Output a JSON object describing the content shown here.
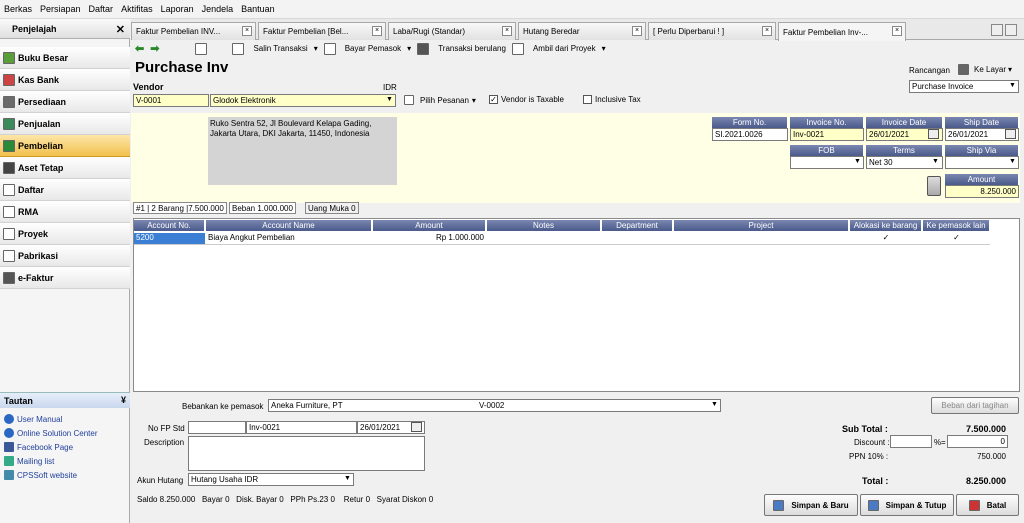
{
  "menu": [
    "Berkas",
    "Persiapan",
    "Daftar",
    "Aktifitas",
    "Laporan",
    "Jendela",
    "Bantuan"
  ],
  "sidebar": {
    "title": "Penjelajah",
    "close": "✕",
    "items": [
      {
        "label": "Buku Besar"
      },
      {
        "label": "Kas Bank"
      },
      {
        "label": "Persediaan"
      },
      {
        "label": "Penjualan"
      },
      {
        "label": "Pembelian"
      },
      {
        "label": "Aset Tetap"
      },
      {
        "label": "Daftar"
      },
      {
        "label": "RMA"
      },
      {
        "label": "Proyek"
      },
      {
        "label": "Pabrikasi"
      },
      {
        "label": "e-Faktur"
      }
    ],
    "tautan": "Tautan",
    "links": [
      "User Manual",
      "Online Solution Center",
      "Facebook Page",
      "Mailing list",
      "CPSSoft website"
    ]
  },
  "tabs": [
    "Faktur Pembelian INV...",
    "Faktur Pembelian [Bel...",
    "Laba/Rugi (Standar)",
    "Hutang Beredar",
    "[ Perlu Diperbarui ! ]",
    "Faktur Pembelian Inv-..."
  ],
  "toolbar": {
    "salin": "Salin Transaksi",
    "bayar": "Bayar Pemasok",
    "berulang": "Transaksi berulang",
    "ambil": "Ambil dari Proyek"
  },
  "form": {
    "title": "Purchase Inv",
    "vendor_label": "Vendor",
    "currency": "IDR",
    "vendor_no": "V-0001",
    "vendor_name": "Glodok Elektronik",
    "pilih": "Pilih Pesanan",
    "taxable": "Vendor is Taxable",
    "inclusive": "Inclusive Tax",
    "address": "Ruko Sentra 52, Jl Boulevard Kelapa Gading, Jakarta Utara, DKI Jakarta, 11450, Indonesia",
    "rancangan": "Rancangan",
    "ke_layar": "Ke Layar",
    "template": "Purchase Invoice",
    "form_no_label": "Form No.",
    "form_no": "SI.2021.0026",
    "invoice_no_label": "Invoice No.",
    "invoice_no": "Inv-0021",
    "invoice_date_label": "Invoice Date",
    "invoice_date": "26/01/2021",
    "ship_date_label": "Ship Date",
    "ship_date": "26/01/2021",
    "fob_label": "FOB",
    "terms_label": "Terms",
    "terms": "Net 30",
    "ship_via_label": "Ship Via",
    "amount_label": "Amount",
    "amount": "8.250.000"
  },
  "subtabs": [
    "#1 | 2 Barang |7.500.000",
    "Beban   1.000.000",
    "Uang Muka   0"
  ],
  "grid": {
    "headers": [
      "Account No.",
      "Account Name",
      "Amount",
      "Notes",
      "Department",
      "Project",
      "Alokasi ke barang",
      "Ke pemasok lain"
    ],
    "rows": [
      {
        "account_no": "5200",
        "account_name": "Biaya Angkut Pembelian",
        "amount": "Rp 1.000.000",
        "alokasi": "✓",
        "pemasok": "✓"
      }
    ]
  },
  "bebankan": {
    "label": "Bebankan ke pemasok",
    "vendor": "Aneka Furniture, PT",
    "code": "V-0002",
    "button": "Beban dari tagihan"
  },
  "footer": {
    "nofp_label": "No FP Std",
    "nofp_inv": "Inv-0021",
    "nofp_date": "26/01/2021",
    "desc_label": "Description",
    "akun_label": "Akun Hutang",
    "akun": "Hutang Usaha IDR",
    "subtotal_label": "Sub Total :",
    "subtotal": "7.500.000",
    "discount_label": "Discount :",
    "discount_pct": "%",
    "discount_eq": "=",
    "discount_val": "0",
    "ppn_label": "PPN 10% :",
    "ppn": "750.000",
    "total_label": "Total :",
    "total": "8.250.000",
    "status": "Saldo 8.250.000   Bayar 0   Disk. Bayar 0   PPh Ps.23 0    Retur 0   Syarat Diskon 0",
    "simpan_baru": "Simpan & Baru",
    "simpan_tutup": "Simpan & Tutup",
    "batal": "Batal"
  }
}
